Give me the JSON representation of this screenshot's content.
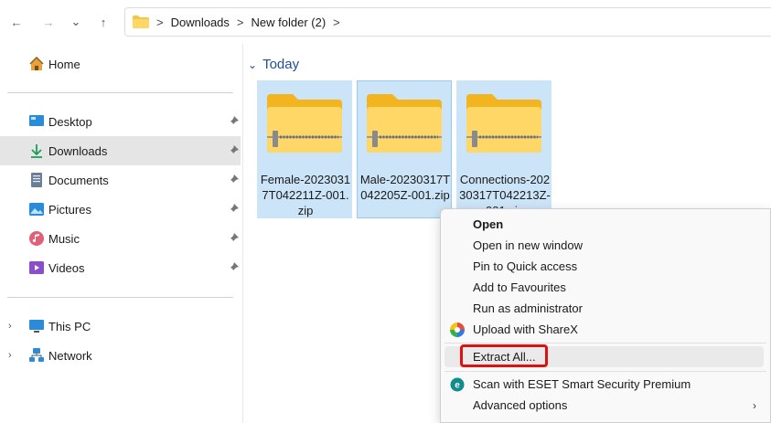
{
  "nav": {
    "back": "←",
    "forward": "→",
    "recent": "⌄",
    "up": "↑"
  },
  "breadcrumb": [
    "Downloads",
    "New folder (2)"
  ],
  "breadcrumb_sep": ">",
  "sidebar": {
    "home": "Home",
    "quick": [
      "Desktop",
      "Downloads",
      "Documents",
      "Pictures",
      "Music",
      "Videos"
    ],
    "this_pc": "This PC",
    "network": "Network"
  },
  "content": {
    "group": "Today",
    "files": [
      "Female-20230317T042211Z-001.zip",
      "Male-20230317T042205Z-001.zip",
      "Connections-20230317T042213Z-001.zip"
    ]
  },
  "context_menu": {
    "open": "Open",
    "open_new_window": "Open in new window",
    "pin_quick": "Pin to Quick access",
    "add_favourites": "Add to Favourites",
    "run_admin": "Run as administrator",
    "upload_sharex": "Upload with ShareX",
    "extract_all": "Extract All...",
    "scan_eset": "Scan with ESET Smart Security Premium",
    "advanced": "Advanced options",
    "submenu_arrow": "›"
  },
  "colors": {
    "selection": "#cce4f7",
    "group_header": "#1f4e9b",
    "highlight": "#e01010"
  }
}
